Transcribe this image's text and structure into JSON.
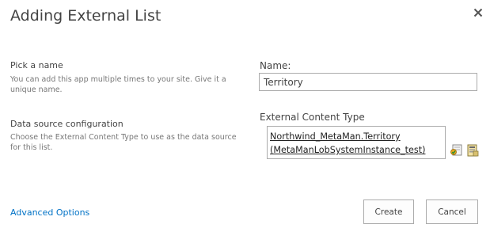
{
  "dialog": {
    "title": "Adding External List",
    "close_icon": "close-icon"
  },
  "name_section": {
    "label": "Pick a name",
    "description": "You can add this app multiple times to your site. Give it a unique name.",
    "field_label": "Name:",
    "value": "Territory"
  },
  "datasource_section": {
    "label": "Data source configuration",
    "description": "Choose the External Content Type to use as the data source for this list.",
    "field_label": "External Content Type",
    "line1": "Northwind_MetaMan.Territory",
    "line2": "(MetaManLobSystemInstance_test)",
    "icons": [
      "check-names-icon",
      "browse-icon"
    ]
  },
  "footer": {
    "advanced_link": "Advanced Options",
    "create_label": "Create",
    "cancel_label": "Cancel"
  }
}
